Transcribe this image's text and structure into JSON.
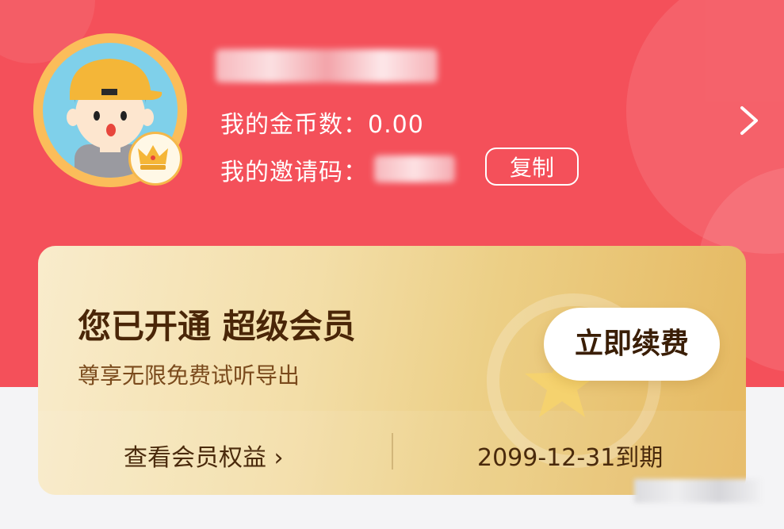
{
  "profile": {
    "gold_label": "我的金币数：",
    "gold_value": "0.00",
    "invite_label": "我的邀请码：",
    "copy_button": "复制"
  },
  "vip": {
    "title": "您已开通 超级会员",
    "subtitle": "尊享无限免费试听导出",
    "renew_button": "立即续费",
    "benefits_link": "查看会员权益 ›",
    "expiry": "2099-12-31到期"
  },
  "colors": {
    "header_bg": "#f4505a",
    "gold_accent": "#e5b860",
    "title_brown": "#4a2608"
  },
  "icons": {
    "profile_arrow": "chevron-right-icon",
    "vip_badge": "crown-icon",
    "medal": "star-icon"
  }
}
